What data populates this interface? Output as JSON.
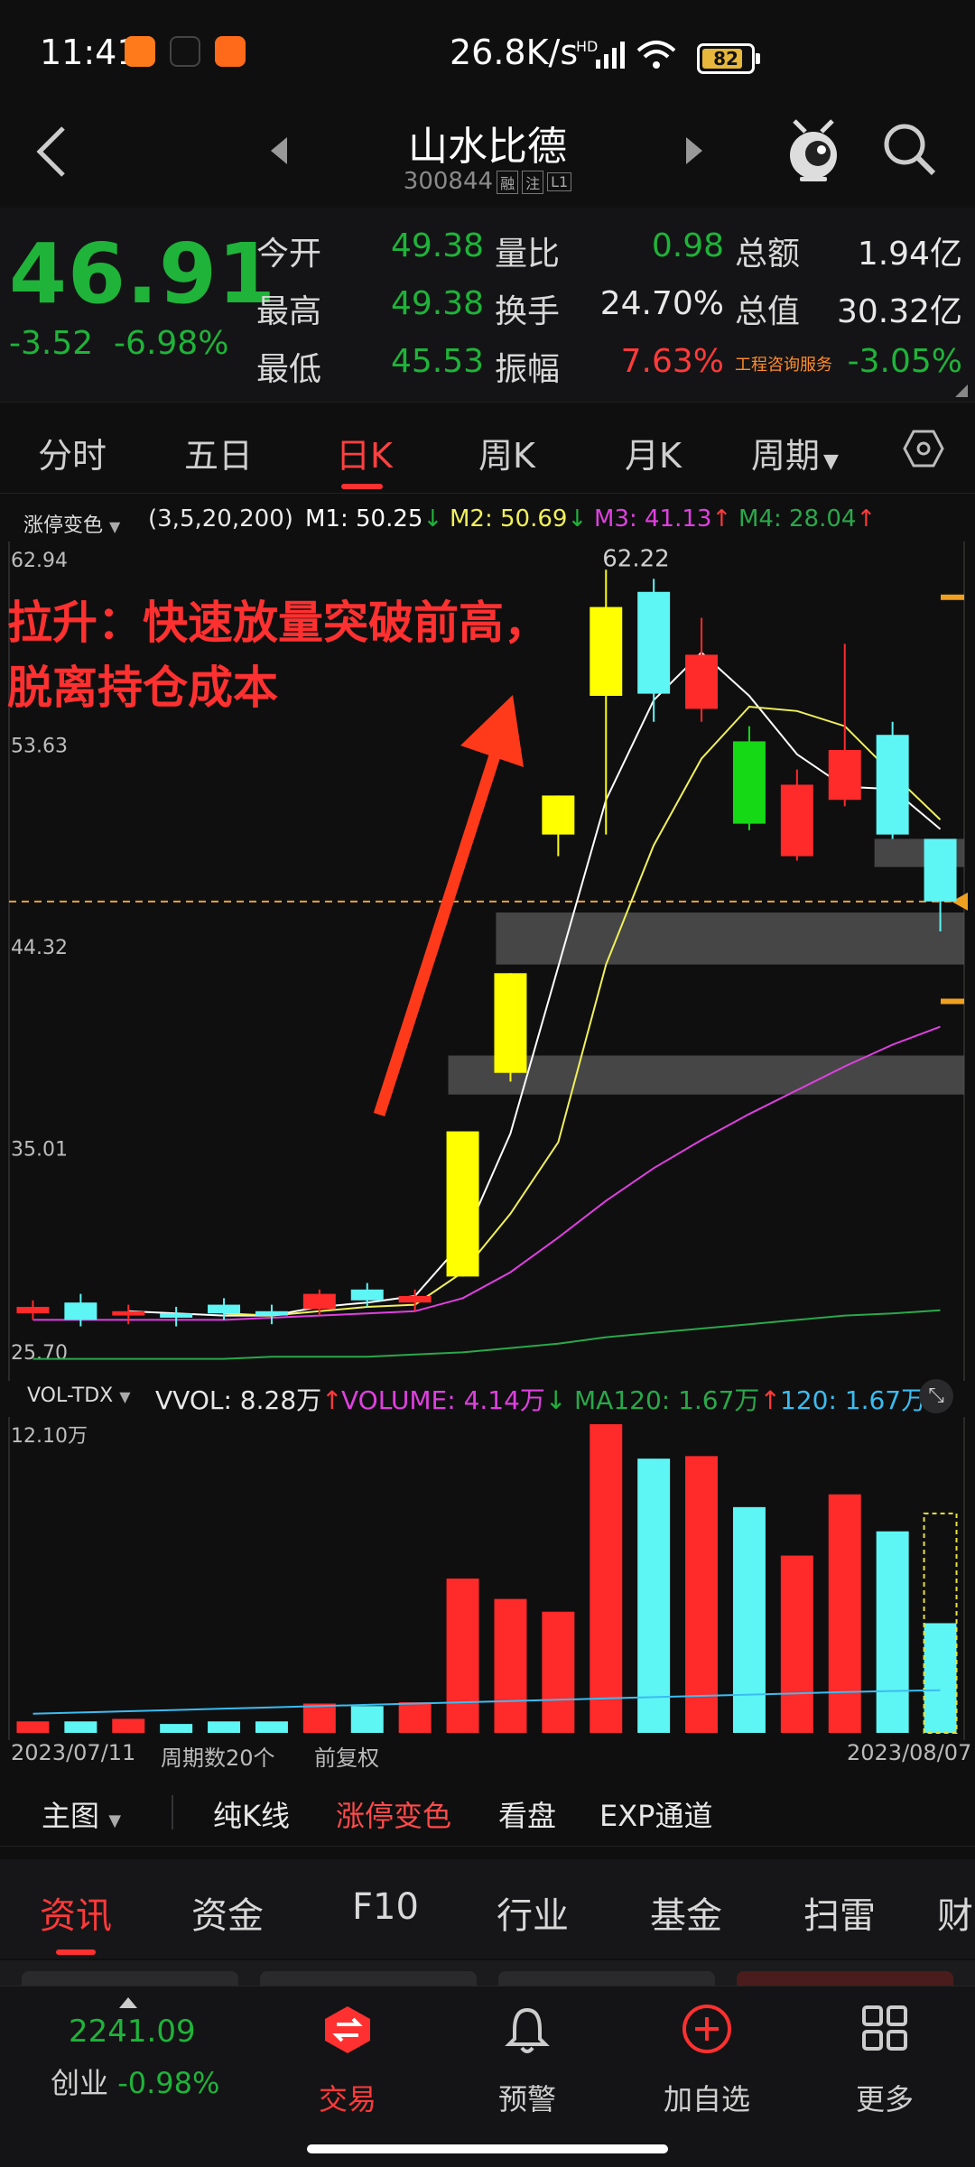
{
  "status_bar": {
    "time": "11:41",
    "net_speed": "26.8K/s",
    "net_type": "HD",
    "battery": "82"
  },
  "header": {
    "title": "山水比德",
    "code": "300844",
    "tags": [
      "融",
      "注",
      "L1"
    ]
  },
  "quote": {
    "price": "46.91",
    "change": "-3.52",
    "change_pct": "-6.98%",
    "rows": [
      [
        {
          "label": "今开",
          "value": "49.38",
          "color": "#1fb33a"
        },
        {
          "label": "量比",
          "value": "0.98",
          "color": "#1fb33a"
        },
        {
          "label": "总额",
          "value": "1.94亿",
          "color": "#e8e8e8"
        }
      ],
      [
        {
          "label": "最高",
          "value": "49.38",
          "color": "#1fb33a"
        },
        {
          "label": "换手",
          "value": "24.70%",
          "color": "#e8e8e8"
        },
        {
          "label": "总值",
          "value": "30.32亿",
          "color": "#e8e8e8"
        }
      ],
      [
        {
          "label": "最低",
          "value": "45.53",
          "color": "#1fb33a"
        },
        {
          "label": "振幅",
          "value": "7.63%",
          "color": "#ff3a3a"
        },
        {
          "label": "工程咨询服务",
          "value": "-3.05%",
          "color": "#1fb33a"
        }
      ]
    ]
  },
  "period_tabs": [
    "分时",
    "五日",
    "日K",
    "周K",
    "月K",
    "周期"
  ],
  "active_period": "日K",
  "indicators": {
    "name": "涨停变色",
    "params": "(3,5,20,200)",
    "m1": {
      "label": "M1: 50.25",
      "arrow": "↓"
    },
    "m2": {
      "label": "M2: 50.69",
      "arrow": "↓"
    },
    "m3": {
      "label": "M3: 41.13",
      "arrow": "↑"
    },
    "m4": {
      "label": "M4: 28.04",
      "arrow": "↑"
    }
  },
  "annotation": {
    "line1": "拉升：快速放量突破前高，",
    "line2": "脱离持仓成本"
  },
  "volume_indicators": {
    "name": "VOL-TDX",
    "vvol": {
      "label": "VVOL: 8.28万",
      "arrow": "↑"
    },
    "volume": {
      "label": "VOLUME: 4.14万",
      "arrow": "↓"
    },
    "ma120": {
      "label": "MA120: 1.67万",
      "arrow": "↑"
    },
    "v120": {
      "label": "120: 1.67万"
    }
  },
  "chart_footer": {
    "start_date": "2023/07/11",
    "period_count": "周期数20个",
    "adjust": "前复权",
    "end_date": "2023/08/07"
  },
  "chart_toolbar": [
    "主图",
    "纯K线",
    "涨停变色",
    "看盘",
    "EXP通道"
  ],
  "info_tabs": [
    "资讯",
    "资金",
    "F10",
    "行业",
    "基金",
    "扫雷",
    "财"
  ],
  "bottom_nav": {
    "index_value": "2241.09",
    "index_name": "创业",
    "index_change": "-0.98%",
    "items": [
      "交易",
      "预警",
      "加自选",
      "更多"
    ]
  },
  "chart_data": [
    {
      "type": "candlestick",
      "y_tick_labels": [
        "62.94",
        "53.63",
        "44.32",
        "35.01",
        "25.70"
      ],
      "ylim": [
        25.7,
        62.94
      ],
      "high_label": "62.22",
      "last_price": 46.91,
      "candles": [
        {
          "open": 27.9,
          "close": 28.2,
          "high": 28.5,
          "low": 27.6,
          "color": "#ff2a2a"
        },
        {
          "open": 28.4,
          "close": 27.6,
          "high": 28.8,
          "low": 27.3,
          "color": "#5ef5f5"
        },
        {
          "open": 27.8,
          "close": 28.0,
          "high": 28.3,
          "low": 27.4,
          "color": "#ff2a2a"
        },
        {
          "open": 27.9,
          "close": 27.7,
          "high": 28.2,
          "low": 27.3,
          "color": "#5ef5f5"
        },
        {
          "open": 28.3,
          "close": 27.9,
          "high": 28.6,
          "low": 27.6,
          "color": "#5ef5f5"
        },
        {
          "open": 28.0,
          "close": 27.8,
          "high": 28.3,
          "low": 27.4,
          "color": "#5ef5f5"
        },
        {
          "open": 28.1,
          "close": 28.8,
          "high": 29.0,
          "low": 27.8,
          "color": "#ff2a2a"
        },
        {
          "open": 29.0,
          "close": 28.5,
          "high": 29.3,
          "low": 28.2,
          "color": "#5ef5f5"
        },
        {
          "open": 28.4,
          "close": 28.7,
          "high": 29.0,
          "low": 28.0,
          "color": "#ff2a2a"
        },
        {
          "open": 29.6,
          "close": 36.3,
          "high": 36.3,
          "low": 29.6,
          "color": "#ffff00"
        },
        {
          "open": 39.0,
          "close": 43.6,
          "high": 43.6,
          "low": 38.6,
          "color": "#ffff00"
        },
        {
          "open": 50.0,
          "close": 51.8,
          "high": 51.8,
          "low": 49.0,
          "color": "#ffff00"
        },
        {
          "open": 56.4,
          "close": 60.5,
          "high": 62.22,
          "low": 50.0,
          "color": "#ffff00"
        },
        {
          "open": 61.2,
          "close": 56.5,
          "high": 61.8,
          "low": 55.2,
          "color": "#5ef5f5"
        },
        {
          "open": 55.8,
          "close": 58.3,
          "high": 60.0,
          "low": 55.2,
          "color": "#ff2a2a"
        },
        {
          "open": 54.3,
          "close": 50.5,
          "high": 55.0,
          "low": 50.2,
          "color": "#16d916"
        },
        {
          "open": 49.0,
          "close": 52.3,
          "high": 53.0,
          "low": 48.8,
          "color": "#ff2a2a"
        },
        {
          "open": 51.6,
          "close": 53.9,
          "high": 58.8,
          "low": 51.3,
          "color": "#ff2a2a"
        },
        {
          "open": 54.6,
          "close": 50.0,
          "high": 55.2,
          "low": 49.8,
          "color": "#5ef5f5"
        },
        {
          "open": 49.8,
          "close": 46.91,
          "high": 49.8,
          "low": 45.53,
          "color": "#5ef5f5"
        }
      ],
      "series": [
        {
          "name": "M1",
          "color": "#ffffff",
          "values": [
            null,
            null,
            28.0,
            27.9,
            27.8,
            27.8,
            28.2,
            28.4,
            28.7,
            31.2,
            36.2,
            43.9,
            51.6,
            56.2,
            58.4,
            56.4,
            53.7,
            52.2,
            52.1,
            50.25
          ]
        },
        {
          "name": "M2",
          "color": "#f0f05a",
          "values": [
            null,
            null,
            null,
            null,
            27.9,
            27.8,
            28.0,
            28.2,
            28.3,
            29.8,
            32.5,
            35.8,
            44.0,
            49.5,
            53.5,
            55.9,
            55.7,
            55.0,
            52.8,
            50.69
          ]
        },
        {
          "name": "M3",
          "color": "#e040e0",
          "values": [
            27.6,
            27.6,
            27.6,
            27.6,
            27.6,
            27.7,
            27.8,
            27.9,
            28.0,
            28.6,
            29.8,
            31.4,
            33.1,
            34.6,
            35.9,
            37.1,
            38.2,
            39.3,
            40.3,
            41.13
          ]
        },
        {
          "name": "M4",
          "color": "#2aa84a",
          "values": [
            25.8,
            25.8,
            25.8,
            25.8,
            25.8,
            25.9,
            25.9,
            25.9,
            26.0,
            26.1,
            26.3,
            26.5,
            26.8,
            27.0,
            27.2,
            27.4,
            27.6,
            27.8,
            27.9,
            28.04
          ]
        }
      ],
      "zones": [
        {
          "low": 48.5,
          "high": 49.8
        },
        {
          "low": 44.0,
          "high": 46.4
        },
        {
          "low": 38.0,
          "high": 39.8
        }
      ]
    },
    {
      "type": "bar",
      "ylim": [
        0,
        12.1
      ],
      "y_tick_label": "12.10万",
      "values": [
        0.45,
        0.45,
        0.55,
        0.35,
        0.45,
        0.45,
        1.15,
        1.05,
        1.2,
        6.05,
        5.25,
        4.75,
        12.1,
        10.75,
        10.85,
        8.85,
        6.95,
        9.35,
        7.9,
        4.3
      ],
      "colors": [
        "#ff2a2a",
        "#5ef5f5",
        "#ff2a2a",
        "#5ef5f5",
        "#5ef5f5",
        "#5ef5f5",
        "#ff2a2a",
        "#5ef5f5",
        "#ff2a2a",
        "#ff2a2a",
        "#ff2a2a",
        "#ff2a2a",
        "#ff2a2a",
        "#5ef5f5",
        "#ff2a2a",
        "#5ef5f5",
        "#ff2a2a",
        "#ff2a2a",
        "#5ef5f5",
        "#5ef5f5"
      ],
      "projected_last": 8.6,
      "ma_line": [
        0.75,
        0.8,
        0.85,
        0.9,
        0.95,
        1.0,
        1.05,
        1.1,
        1.15,
        1.2,
        1.25,
        1.3,
        1.35,
        1.4,
        1.45,
        1.5,
        1.55,
        1.6,
        1.64,
        1.67
      ]
    }
  ]
}
